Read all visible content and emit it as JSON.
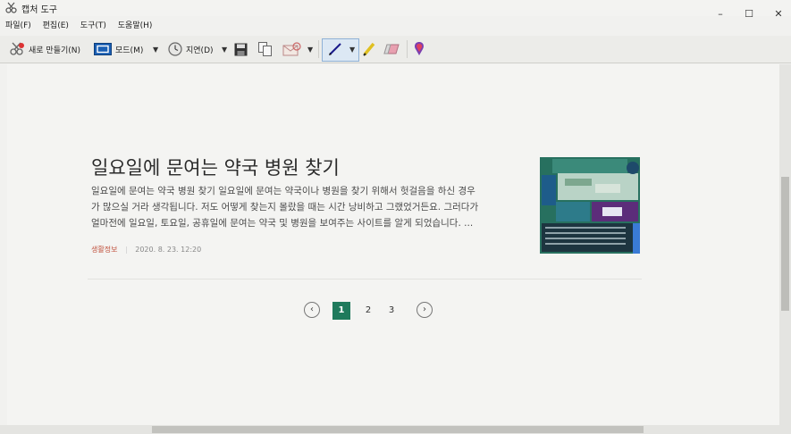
{
  "window": {
    "title": "캡처 도구",
    "controls": [
      "–",
      "☐",
      "✕"
    ]
  },
  "menu": [
    "파일(F)",
    "편집(E)",
    "도구(T)",
    "도움말(H)"
  ],
  "toolbar": {
    "new_label": "새로 만들기(N)",
    "mode_label": "모드(M)",
    "delay_label": "지연(D)"
  },
  "post": {
    "title": "일요일에 문여는 약국 병원 찾기",
    "excerpt_lines": [
      "일요일에 문여는 약국 병원 찾기 일요일에 문여는 약국이나 병원을 찾기 위해서 헛걸음을 하신 경우",
      "가 많으실 거라 생각됩니다. 저도 어떻게 찾는지 몰랐을 때는 시간 낭비하고 그랬었거든요. 그러다가",
      "얼마전에 일요일, 토요일, 공휴일에 문여는 약국 및 병원을 보여주는 사이트를 알게 되었습니다. ..."
    ],
    "category": "생활정보",
    "date": "2020. 8. 23. 12:20"
  },
  "pagination": {
    "prev": "‹",
    "pages": [
      "1",
      "2",
      "3"
    ],
    "current": "1",
    "next": "›"
  },
  "colors": {
    "accent": "#1f7a5c",
    "thumb_bg": "#27705f",
    "thumb_purple": "#5c2d7a"
  }
}
